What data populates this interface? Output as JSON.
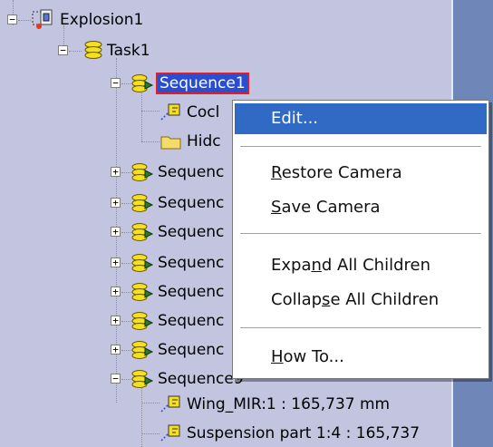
{
  "tree": {
    "root": {
      "label": "Explosion1",
      "expander": "−"
    },
    "task": {
      "label": "Task1",
      "expander": "−"
    },
    "sequence_selected": {
      "label": "Sequence1",
      "expander": "−"
    },
    "seq1_children": [
      {
        "label": "Cocl"
      },
      {
        "label": "Hidc"
      }
    ],
    "collapsed_sequences": [
      {
        "label": "Sequenc",
        "expander": "+"
      },
      {
        "label": "Sequenc",
        "expander": "+"
      },
      {
        "label": "Sequenc",
        "expander": "+"
      },
      {
        "label": "Sequenc",
        "expander": "+"
      },
      {
        "label": "Sequenc",
        "expander": "+"
      },
      {
        "label": "Sequenc",
        "expander": "+"
      },
      {
        "label": "Sequenc",
        "expander": "+"
      }
    ],
    "expanded_sequence": {
      "label": "Sequence9",
      "expander": "−"
    },
    "last_children": [
      {
        "label": "Wing_MIR:1 : 165,737 mm"
      },
      {
        "label": "Suspension part 1:4 : 165,737"
      }
    ]
  },
  "menu": {
    "edit": {
      "pre": "Edit...",
      "acc": "",
      "post": ""
    },
    "restore": {
      "pre": "",
      "acc": "R",
      "post": "estore Camera"
    },
    "save": {
      "pre": "",
      "acc": "S",
      "post": "ave Camera"
    },
    "expand": {
      "pre": "Expa",
      "acc": "n",
      "post": "d All Children"
    },
    "collapse": {
      "pre": "Collap",
      "acc": "s",
      "post": "e All Children"
    },
    "howto": {
      "pre": "",
      "acc": "H",
      "post": "ow To..."
    }
  },
  "colors": {
    "tree_bg": "#c2c4e0",
    "selection": "#2a4ed1",
    "menu_highlight": "#316ac5",
    "right_strip": "#6f86b9"
  }
}
